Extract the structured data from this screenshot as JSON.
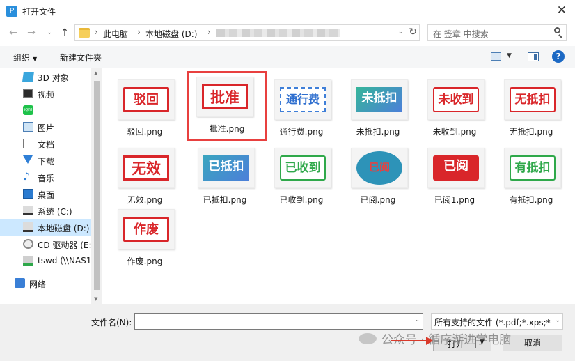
{
  "window": {
    "title": "打开文件"
  },
  "address": {
    "crumbs": [
      "此电脑",
      "本地磁盘 (D:)"
    ],
    "search_placeholder": "在 签章 中搜索"
  },
  "toolbar": {
    "organize": "组织",
    "new_folder": "新建文件夹"
  },
  "sidebar": {
    "items": [
      {
        "label": "3D 对象",
        "icon": "cube-icon"
      },
      {
        "label": "视频",
        "icon": "video-icon"
      },
      {
        "label": "",
        "icon": "iqiyi-icon"
      },
      {
        "label": "图片",
        "icon": "pictures-icon"
      },
      {
        "label": "文档",
        "icon": "documents-icon"
      },
      {
        "label": "下载",
        "icon": "download-icon"
      },
      {
        "label": "音乐",
        "icon": "music-icon"
      },
      {
        "label": "桌面",
        "icon": "desktop-icon"
      },
      {
        "label": "系统 (C:)",
        "icon": "drive-c-icon"
      },
      {
        "label": "本地磁盘 (D:)",
        "icon": "drive-d-icon",
        "selected": true
      },
      {
        "label": "CD 驱动器 (E:",
        "icon": "cd-drive-icon"
      },
      {
        "label": "tswd (\\\\NAS1",
        "icon": "network-drive-icon"
      },
      {
        "label": "网络",
        "icon": "network-icon"
      }
    ]
  },
  "files": [
    {
      "name": "驳回.png",
      "stamp": "驳回",
      "style": "red-box"
    },
    {
      "name": "批准.png",
      "stamp": "批准",
      "style": "red-box-bold",
      "selected": true
    },
    {
      "name": "通行费.png",
      "stamp": "通行费",
      "style": "blue-dashed"
    },
    {
      "name": "未抵扣.png",
      "stamp": "未抵扣",
      "style": "gradient"
    },
    {
      "name": "未收到.png",
      "stamp": "未收到",
      "style": "red-outline"
    },
    {
      "name": "无抵扣.png",
      "stamp": "无抵扣",
      "style": "red-outline"
    },
    {
      "name": "无效.png",
      "stamp": "无效",
      "style": "red-box-bold"
    },
    {
      "name": "已抵扣.png",
      "stamp": "已抵扣",
      "style": "teal-blue"
    },
    {
      "name": "已收到.png",
      "stamp": "已收到",
      "style": "green-outline"
    },
    {
      "name": "已阅.png",
      "stamp": "已阅",
      "style": "bubble"
    },
    {
      "name": "已阅1.png",
      "stamp": "已阅",
      "style": "red-fill"
    },
    {
      "name": "有抵扣.png",
      "stamp": "有抵扣",
      "style": "green-outline"
    },
    {
      "name": "作废.png",
      "stamp": "作废",
      "style": "red-box"
    }
  ],
  "bottom": {
    "filename_label": "文件名(N):",
    "filename_value": "",
    "filter": "所有支持的文件 (*.pdf;*.xps;*.c",
    "open": "打开",
    "cancel": "取消"
  },
  "watermark": {
    "text": "公众号 · 循序渐进学电脑"
  },
  "colors": {
    "accent": "#1c69c4",
    "selection": "#cce8ff",
    "highlight_box": "#e8403f",
    "stamp_red": "#d9262a"
  }
}
